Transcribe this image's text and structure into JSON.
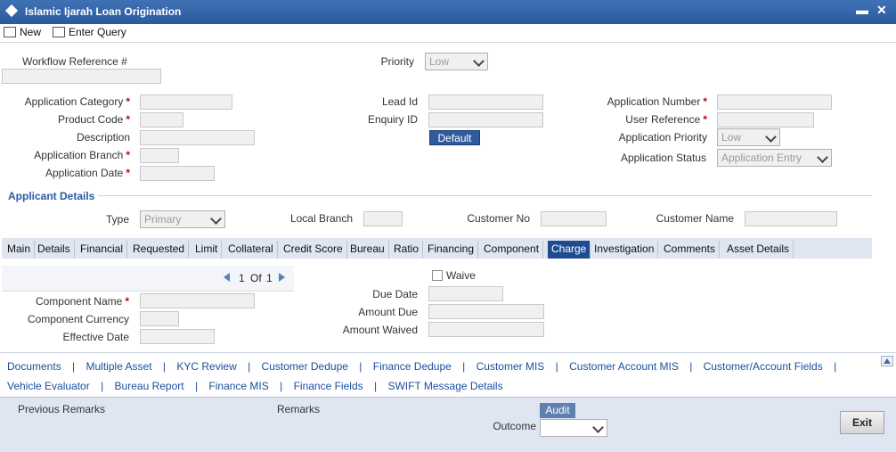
{
  "window": {
    "title": "Islamic Ijarah Loan Origination",
    "minimize": "▬",
    "close": "✕"
  },
  "toolbar": {
    "new_label": "New",
    "enter_query_label": "Enter Query"
  },
  "header": {
    "workflow_ref_label": "Workflow Reference #",
    "priority_label": "Priority",
    "priority_value": "Low",
    "app_category_label": "Application Category",
    "product_code_label": "Product Code",
    "description_label": "Description",
    "app_branch_label": "Application Branch",
    "app_date_label": "Application Date",
    "lead_id_label": "Lead Id",
    "enquiry_id_label": "Enquiry ID",
    "default_button": "Default",
    "app_number_label": "Application Number",
    "user_ref_label": "User Reference",
    "app_priority_label": "Application Priority",
    "app_priority_value": "Low",
    "app_status_label": "Application Status",
    "app_status_value": "Application Entry",
    "required_mark": "*"
  },
  "applicant": {
    "section_title": "Applicant Details",
    "type_label": "Type",
    "type_value": "Primary",
    "local_branch_label": "Local Branch",
    "customer_no_label": "Customer No",
    "customer_name_label": "Customer Name"
  },
  "tabs": [
    "Main",
    "Details",
    "Financial",
    "Requested",
    "Limit",
    "Collateral",
    "Credit Score",
    "Bureau",
    "Ratio",
    "Financing",
    "Component",
    "Charge",
    "Investigation",
    "Comments",
    "Asset Details"
  ],
  "active_tab": "Charge",
  "charge": {
    "pager_current": "1",
    "pager_of": "Of",
    "pager_total": "1",
    "component_name_label": "Component Name",
    "component_currency_label": "Component Currency",
    "effective_date_label": "Effective Date",
    "waive_label": "Waive",
    "due_date_label": "Due Date",
    "amount_due_label": "Amount Due",
    "amount_waived_label": "Amount Waived"
  },
  "links_row1": [
    "Documents",
    "Multiple Asset",
    "KYC Review",
    "Customer Dedupe",
    "Finance Dedupe",
    "Customer MIS",
    "Customer Account MIS",
    "Customer/Account Fields"
  ],
  "links_row2": [
    "Vehicle Evaluator",
    "Bureau Report",
    "Finance MIS",
    "Finance Fields",
    "SWIFT Message Details"
  ],
  "separator": "|",
  "footer": {
    "previous_remarks_label": "Previous Remarks",
    "remarks_label": "Remarks",
    "audit_button": "Audit",
    "outcome_label": "Outcome",
    "exit_button": "Exit"
  }
}
